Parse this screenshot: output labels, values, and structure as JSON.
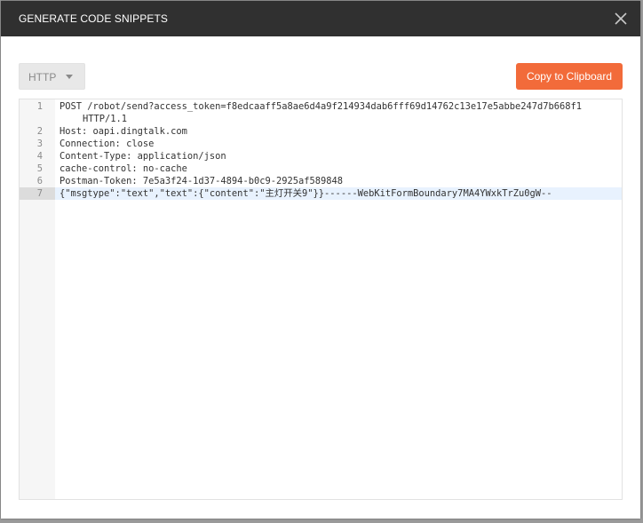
{
  "modal": {
    "title": "GENERATE CODE SNIPPETS",
    "close_icon": "close-icon"
  },
  "toolbar": {
    "language": "HTTP",
    "copy_label": "Copy to Clipboard",
    "accent_color": "#f26b3a"
  },
  "editor": {
    "active_line": 7,
    "lines": [
      {
        "number": "1",
        "text": "POST /robot/send?access_token=f8edcaaff5a8ae6d4a9f214934dab6fff69d14762c13e17e5abbe247d7b668f1",
        "continuation": "HTTP/1.1"
      },
      {
        "number": "2",
        "text": "Host: oapi.dingtalk.com"
      },
      {
        "number": "3",
        "text": "Connection: close"
      },
      {
        "number": "4",
        "text": "Content-Type: application/json"
      },
      {
        "number": "5",
        "text": "cache-control: no-cache"
      },
      {
        "number": "6",
        "text": "Postman-Token: 7e5a3f24-1d37-4894-b0c9-2925af589848"
      },
      {
        "number": "7",
        "text": "{\"msgtype\":\"text\",\"text\":{\"content\":\"主灯开关9\"}}------WebKitFormBoundary7MA4YWxkTrZu0gW--"
      }
    ]
  }
}
